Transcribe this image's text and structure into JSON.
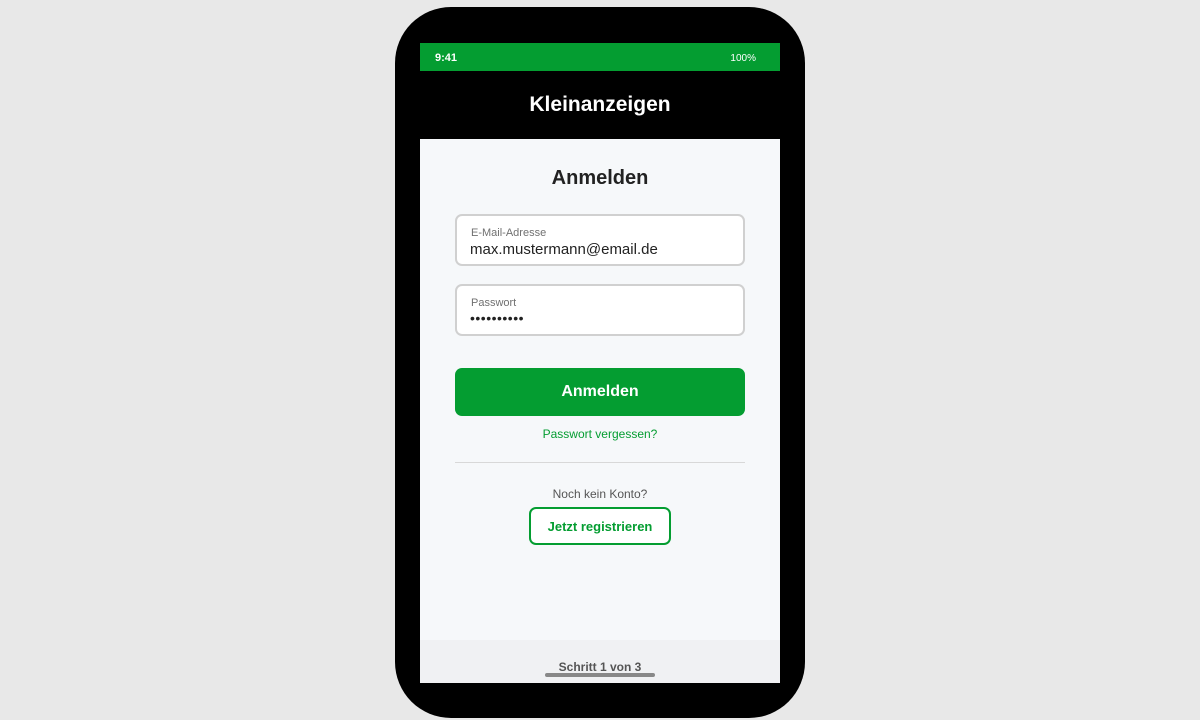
{
  "status_bar": {
    "time": "9:41",
    "battery": "100%"
  },
  "header": {
    "title": "Kleinanzeigen"
  },
  "login_form": {
    "title": "Anmelden",
    "email": {
      "label": "E-Mail-Adresse",
      "value": "max.mustermann@email.de"
    },
    "password": {
      "label": "Passwort",
      "value": "••••••••••"
    },
    "submit_label": "Anmelden",
    "forgot_password": "Passwort vergessen?",
    "no_account": "Noch kein Konto?",
    "register_label": "Jetzt registrieren"
  },
  "footer": {
    "step": "Schritt 1 von 3"
  },
  "colors": {
    "brand_green": "#049d31",
    "header_black": "#000000",
    "screen_bg": "#f6f8fa"
  }
}
